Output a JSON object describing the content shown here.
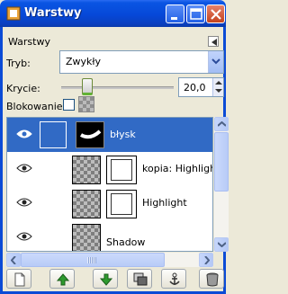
{
  "window": {
    "title": "Warstwy",
    "title_color": "#0a4fd7"
  },
  "panel": {
    "title": "Warstwy",
    "mode_label": "Tryb:",
    "mode_value": "Zwykły",
    "opacity_label": "Krycie:",
    "opacity_value": "20,0",
    "opacity_level": 0.2,
    "lock_label": "Blokowanie:"
  },
  "layers": [
    {
      "name": "błysk",
      "visible": true,
      "selected": true
    },
    {
      "name": "kopia: Highlight",
      "visible": true,
      "selected": false
    },
    {
      "name": "Highlight",
      "visible": true,
      "selected": false
    },
    {
      "name": "Shadow",
      "visible": true,
      "selected": false
    }
  ],
  "toolbar": {
    "buttons": [
      "new-layer-icon",
      "raise-layer-icon",
      "lower-layer-icon",
      "duplicate-layer-icon",
      "anchor-layer-icon",
      "delete-layer-icon"
    ]
  },
  "colors": {
    "selection": "#316ac5",
    "titlebar": "#0a4fd7",
    "raise_arrow": "#2e9a2e"
  }
}
